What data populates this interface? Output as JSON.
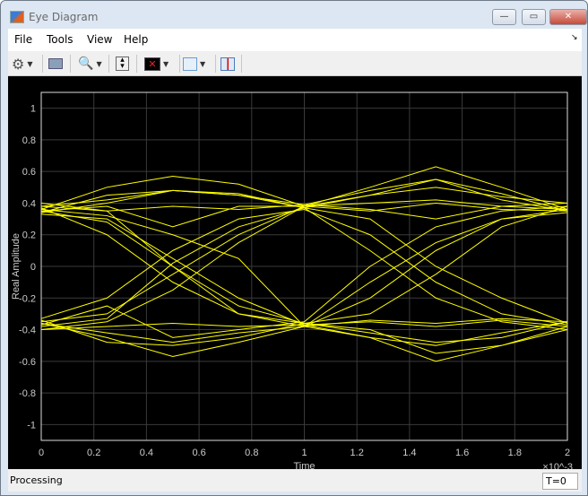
{
  "window": {
    "title": "Eye Diagram",
    "min": "—",
    "max": "▭",
    "close": "✕"
  },
  "menu": [
    "File",
    "Tools",
    "View",
    "Help"
  ],
  "toolbar": {
    "icons": [
      "gear-icon",
      "print-icon",
      "zoom-in-icon",
      "autoscale-icon",
      "eye-measure-icon",
      "bathtub-icon",
      "cursor-icon"
    ]
  },
  "status": {
    "text": "Processing",
    "time": "T=0"
  },
  "colors": {
    "trace": "#ffff00",
    "bg": "#000000",
    "grid": "#3a3a3a"
  },
  "chart_data": {
    "type": "line",
    "xlabel": "Time",
    "ylabel": "Real Amplitude",
    "x_exponent": "×10^-3",
    "x_exp_base": "×10",
    "x_exp_power": "-3",
    "xlim": [
      0,
      2
    ],
    "ylim": [
      -1.1,
      1.1
    ],
    "grid": true,
    "xticks": [
      "0",
      "0.2",
      "0.4",
      "0.6",
      "0.8",
      "1",
      "1.2",
      "1.4",
      "1.6",
      "1.8",
      "2"
    ],
    "yticks": [
      "1",
      "0.8",
      "0.6",
      "0.4",
      "0.2",
      "0",
      "-0.2",
      "-0.4",
      "-0.6",
      "-0.8",
      "-1"
    ],
    "x": [
      0,
      0.25,
      0.5,
      0.75,
      1,
      1.25,
      1.5,
      1.75,
      2
    ],
    "series": [
      [
        0.36,
        0.5,
        0.57,
        0.52,
        0.38,
        0.5,
        0.63,
        0.5,
        0.36
      ],
      [
        0.34,
        0.45,
        0.48,
        0.45,
        0.39,
        0.48,
        0.55,
        0.46,
        0.35
      ],
      [
        0.38,
        0.42,
        0.48,
        0.46,
        0.37,
        0.45,
        0.5,
        0.44,
        0.4
      ],
      [
        0.33,
        0.3,
        0.05,
        -0.2,
        -0.37,
        -0.45,
        -0.5,
        -0.42,
        -0.35
      ],
      [
        0.4,
        0.35,
        0.0,
        -0.25,
        -0.36,
        -0.4,
        -0.55,
        -0.5,
        -0.38
      ],
      [
        0.36,
        0.32,
        0.2,
        0.05,
        -0.38,
        -0.2,
        0.1,
        0.3,
        0.36
      ],
      [
        -0.35,
        -0.3,
        -0.05,
        0.2,
        0.38,
        0.45,
        0.55,
        0.42,
        0.35
      ],
      [
        -0.38,
        -0.33,
        0.02,
        0.25,
        0.37,
        0.3,
        0.0,
        -0.2,
        -0.36
      ],
      [
        -0.36,
        -0.45,
        -0.57,
        -0.48,
        -0.38,
        -0.45,
        -0.6,
        -0.5,
        -0.4
      ],
      [
        -0.34,
        -0.48,
        -0.5,
        -0.45,
        -0.36,
        -0.42,
        -0.48,
        -0.45,
        -0.35
      ],
      [
        -0.4,
        -0.38,
        -0.36,
        -0.38,
        -0.37,
        -0.35,
        -0.38,
        -0.34,
        -0.38
      ],
      [
        0.35,
        0.38,
        0.25,
        0.38,
        0.38,
        0.4,
        0.42,
        0.38,
        0.36
      ],
      [
        -0.37,
        -0.25,
        -0.45,
        -0.4,
        -0.35,
        0.0,
        0.25,
        0.35,
        0.38
      ],
      [
        0.37,
        0.2,
        -0.1,
        -0.3,
        -0.38,
        -0.1,
        0.15,
        0.3,
        0.34
      ],
      [
        -0.33,
        -0.2,
        0.1,
        0.3,
        0.36,
        0.2,
        -0.1,
        -0.3,
        -0.37
      ],
      [
        0.34,
        0.4,
        0.48,
        0.45,
        0.37,
        0.1,
        -0.2,
        -0.35,
        -0.4
      ],
      [
        -0.36,
        -0.42,
        -0.48,
        -0.42,
        -0.38,
        -0.34,
        -0.36,
        -0.33,
        -0.35
      ],
      [
        0.38,
        0.35,
        0.38,
        0.36,
        0.39,
        0.36,
        0.3,
        0.38,
        0.4
      ],
      [
        -0.4,
        -0.35,
        -0.15,
        0.15,
        0.38,
        0.35,
        0.4,
        0.36,
        0.35
      ],
      [
        0.35,
        0.28,
        0.0,
        -0.3,
        -0.36,
        -0.3,
        -0.05,
        0.25,
        0.38
      ]
    ]
  }
}
